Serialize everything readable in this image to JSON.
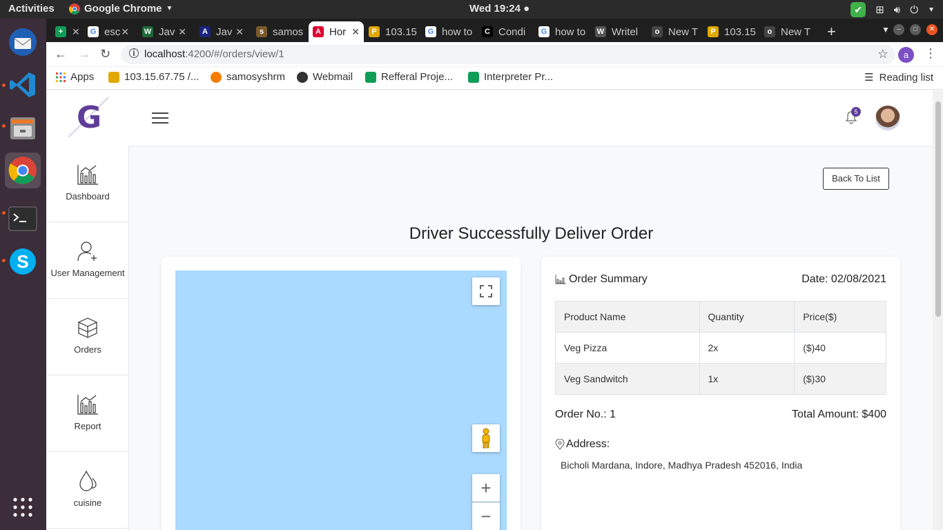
{
  "system": {
    "activities": "Activities",
    "app_menu": "Google Chrome",
    "clock": "Wed 19:24"
  },
  "dock": {
    "items": [
      "thunderbird-icon",
      "vscode-icon",
      "files-icon",
      "chrome-icon",
      "terminal-icon",
      "skype-icon",
      "app-grid-icon"
    ]
  },
  "tabs": [
    {
      "label": "",
      "favicon_color": "#0f9d58",
      "favicon_glyph": "+"
    },
    {
      "label": "esc",
      "favicon_color": "#ffffff",
      "favicon_glyph": "G"
    },
    {
      "label": "Jav",
      "favicon_color": "#1d6a3a",
      "favicon_glyph": "W"
    },
    {
      "label": "Jav",
      "favicon_color": "#1a237e",
      "favicon_glyph": "A"
    },
    {
      "label": "samos",
      "favicon_color": "#7a5a2a",
      "favicon_glyph": "s"
    },
    {
      "label": "Hor",
      "favicon_color": "#dd0031",
      "favicon_glyph": "A"
    },
    {
      "label": "103.15",
      "favicon_color": "#e0a800",
      "favicon_glyph": "P"
    },
    {
      "label": "how to",
      "favicon_color": "#ffffff",
      "favicon_glyph": "G"
    },
    {
      "label": "Condi",
      "favicon_color": "#000000",
      "favicon_glyph": "C"
    },
    {
      "label": "how to",
      "favicon_color": "#ffffff",
      "favicon_glyph": "G"
    },
    {
      "label": "Writel",
      "favicon_color": "#555555",
      "favicon_glyph": "W"
    },
    {
      "label": "New T",
      "favicon_color": "#444444",
      "favicon_glyph": "o"
    },
    {
      "label": "103.15",
      "favicon_color": "#e0a800",
      "favicon_glyph": "P"
    },
    {
      "label": "New T",
      "favicon_color": "#444444",
      "favicon_glyph": "o"
    }
  ],
  "address": {
    "host": "localhost",
    "path": ":4200/#/orders/view/1",
    "profile_initial": "a"
  },
  "bookmarks": [
    {
      "label": "Apps",
      "color": "#ea4335"
    },
    {
      "label": "103.15.67.75 /...",
      "color": "#e0a800"
    },
    {
      "label": "samosyshrm",
      "color": "#f57c00"
    },
    {
      "label": "Webmail",
      "color": "#333333"
    },
    {
      "label": "Refferal Proje...",
      "color": "#0f9d58"
    },
    {
      "label": "Interpreter Pr...",
      "color": "#0f9d58"
    }
  ],
  "reading_list": "Reading list",
  "app": {
    "logo_letter": "G",
    "brand_color": "#5f3d97",
    "notifications_count": "5"
  },
  "sidebar": {
    "items": [
      {
        "label": "Dashboard",
        "icon": "bar-chart-icon"
      },
      {
        "label": "User Management",
        "icon": "add-user-icon"
      },
      {
        "label": "Orders",
        "icon": "boxes-icon"
      },
      {
        "label": "Report",
        "icon": "bar-chart-icon"
      },
      {
        "label": "cuisine",
        "icon": "drops-icon"
      }
    ]
  },
  "main": {
    "back_button": "Back To List",
    "title": "Driver Successfully Deliver Order"
  },
  "summary": {
    "heading": "Order Summary",
    "date_label": "Date:",
    "date_value": "02/08/2021",
    "columns": [
      "Product Name",
      "Quantity",
      "Price($)"
    ],
    "rows": [
      [
        "Veg Pizza",
        "2x",
        "($)40"
      ],
      [
        "Veg Sandwitch",
        "1x",
        "($)30"
      ]
    ],
    "order_no": "Order No.: 1",
    "total": "Total Amount: $400",
    "address_label": "Address:",
    "address": "Bicholi Mardana, Indore, Madhya Pradesh 452016, India"
  }
}
